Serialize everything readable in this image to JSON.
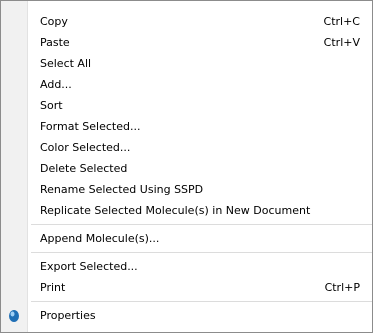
{
  "menu": {
    "items": [
      {
        "label": "Copy",
        "shortcut": "Ctrl+C"
      },
      {
        "label": "Paste",
        "shortcut": "Ctrl+V"
      },
      {
        "label": "Select All",
        "shortcut": ""
      },
      {
        "label": "Add...",
        "shortcut": ""
      },
      {
        "label": "Sort",
        "shortcut": ""
      },
      {
        "label": "Format Selected...",
        "shortcut": ""
      },
      {
        "label": "Color Selected...",
        "shortcut": ""
      },
      {
        "label": "Delete Selected",
        "shortcut": ""
      },
      {
        "label": "Rename Selected Using SSPD",
        "shortcut": ""
      },
      {
        "label": "Replicate Selected Molecule(s) in New Document",
        "shortcut": ""
      },
      {
        "label": "Append Molecule(s)...",
        "shortcut": ""
      },
      {
        "label": "Export Selected...",
        "shortcut": ""
      },
      {
        "label": "Print",
        "shortcut": "Ctrl+P"
      },
      {
        "label": "Properties",
        "shortcut": "",
        "icon": "properties-icon"
      }
    ]
  },
  "colors": {
    "icon_primary": "#1f6fb5",
    "icon_highlight": "#9fd0f5"
  }
}
